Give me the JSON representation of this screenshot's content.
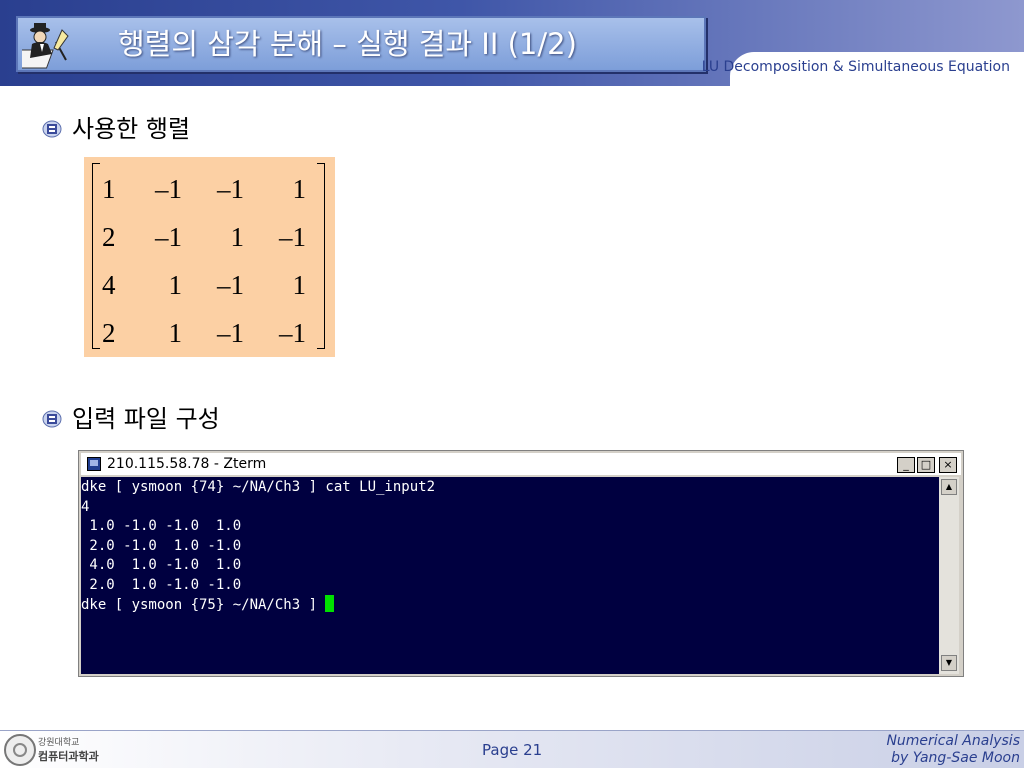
{
  "header": {
    "title": "행렬의 삼각 분해 – 실행 결과 II (1/2)",
    "subtitle": "LU Decomposition & Simultaneous Equation"
  },
  "bullets": [
    {
      "text": "사용한 행렬"
    },
    {
      "text": "입력 파일 구성"
    }
  ],
  "matrix": {
    "rows": [
      [
        "1",
        "–1",
        "–1",
        "1"
      ],
      [
        "2",
        "–1",
        "1",
        "–1"
      ],
      [
        "4",
        "1",
        "–1",
        "1"
      ],
      [
        "2",
        "1",
        "–1",
        "–1"
      ]
    ],
    "background_color": "#fcd0a4"
  },
  "terminal": {
    "window_title": "210.115.58.78 - Zterm",
    "buttons": {
      "minimize": "_",
      "maximize": "□",
      "close": "×"
    },
    "lines": [
      "dke [ ysmoon {74} ~/NA/Ch3 ] cat LU_input2",
      "4",
      " 1.0 -1.0 -1.0  1.0",
      " 2.0 -1.0  1.0 -1.0",
      " 4.0  1.0 -1.0  1.0",
      " 2.0  1.0 -1.0 -1.0"
    ],
    "prompt": "dke [ ysmoon {75} ~/NA/Ch3 ] ",
    "background_color": "#000040",
    "cursor_color": "#00e000"
  },
  "footer": {
    "logo_line1": "강원대학교",
    "logo_line2": "컴퓨터과학과",
    "page": "Page 21",
    "course": "Numerical Analysis",
    "author": "by Yang-Sae Moon"
  },
  "colors": {
    "header_dark": "#2a3f8f",
    "accent_text": "#2a3f8f"
  },
  "icons": {
    "title_icon": "scholar-writing-icon",
    "bullet_icon": "school-emblem-icon"
  }
}
